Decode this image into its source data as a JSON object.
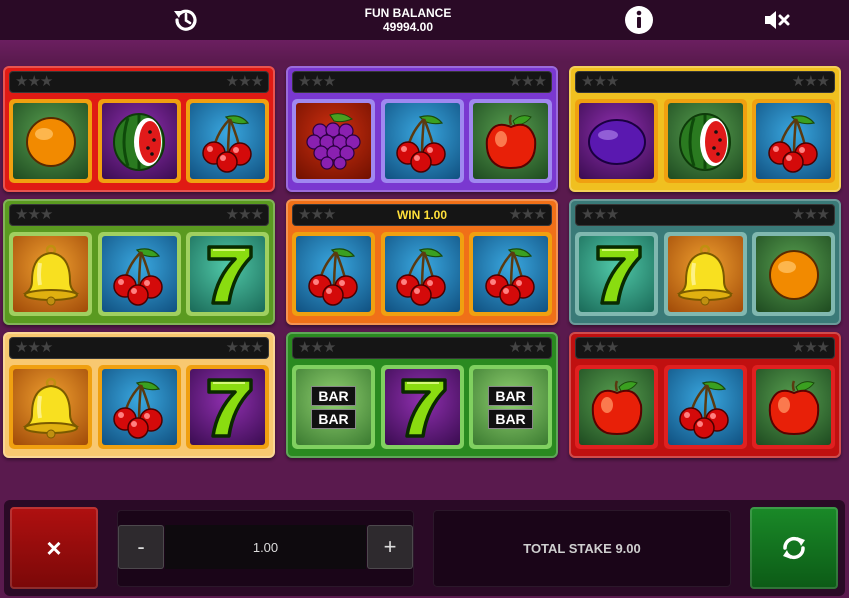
{
  "header": {
    "balance_label": "FUN BALANCE",
    "balance_value": "49994.00",
    "history_icon": "history-icon",
    "info_icon": "info-icon",
    "mute_icon": "speaker-muted-icon"
  },
  "machines": [
    {
      "color": "#e01a14",
      "reel_border": "#f0a010",
      "win": "",
      "symbols": [
        "orange",
        "watermelon",
        "cherries"
      ],
      "reel_bgs": [
        "green",
        "purple",
        "blue"
      ]
    },
    {
      "color": "#7a38d0",
      "reel_border": "#a088f0",
      "win": "",
      "symbols": [
        "grapes",
        "cherries",
        "apple"
      ],
      "reel_bgs": [
        "red",
        "blue",
        "green"
      ]
    },
    {
      "color": "#f0c020",
      "reel_border": "#f0a010",
      "win": "",
      "symbols": [
        "plum",
        "watermelon",
        "cherries"
      ],
      "reel_bgs": [
        "purple",
        "green",
        "blue"
      ]
    },
    {
      "color": "#5a9a20",
      "reel_border": "#a0d060",
      "win": "",
      "symbols": [
        "bell",
        "cherries",
        "seven"
      ],
      "reel_bgs": [
        "orange",
        "blue",
        "teal"
      ]
    },
    {
      "color": "#f07018",
      "reel_border": "#f0a010",
      "win": "WIN 1.00",
      "symbols": [
        "cherries",
        "cherries",
        "cherries"
      ],
      "reel_bgs": [
        "blue",
        "blue",
        "blue"
      ]
    },
    {
      "color": "#3a7a78",
      "reel_border": "#80b8b0",
      "win": "",
      "symbols": [
        "seven",
        "bell",
        "orange"
      ],
      "reel_bgs": [
        "teal",
        "orange",
        "green"
      ]
    },
    {
      "color": "#f8c870",
      "reel_border": "#f0a010",
      "win": "",
      "symbols": [
        "bell",
        "cherries",
        "seven"
      ],
      "reel_bgs": [
        "orange",
        "blue",
        "purple"
      ]
    },
    {
      "color": "#2a8a20",
      "reel_border": "#80d060",
      "win": "",
      "symbols": [
        "bar",
        "seven",
        "bar"
      ],
      "reel_bgs": [
        "lightgreen",
        "purple",
        "lightgreen"
      ]
    },
    {
      "color": "#c01010",
      "reel_border": "#e02020",
      "win": "",
      "symbols": [
        "apple",
        "cherries",
        "apple"
      ],
      "reel_bgs": [
        "green",
        "blue",
        "green"
      ]
    }
  ],
  "bar_text": [
    "BAR",
    "BAR"
  ],
  "controls": {
    "cancel_symbol": "×",
    "stake_minus": "-",
    "stake_value": "1.00",
    "stake_plus": "+",
    "total_stake": "TOTAL STAKE 9.00",
    "spin_icon": "spin-arrows-icon"
  }
}
